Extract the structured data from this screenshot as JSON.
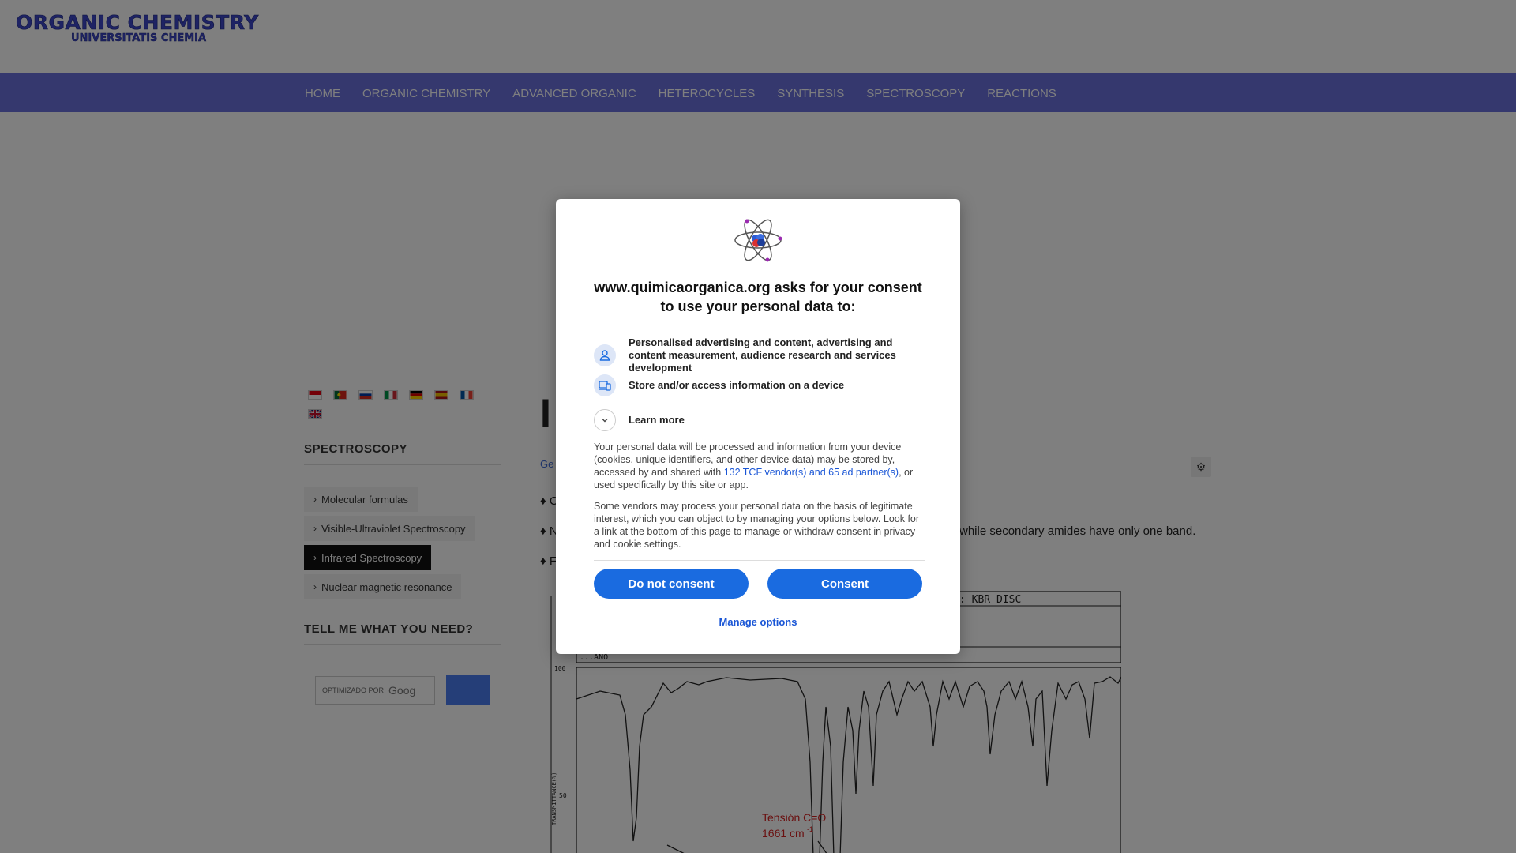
{
  "header": {
    "logo_main": "ORGANIC CHEMISTRY",
    "logo_sub": "UNIVERSITATIS CHEMIA"
  },
  "nav": {
    "items": [
      "HOME",
      "ORGANIC CHEMISTRY",
      "ADVANCED ORGANIC",
      "HETEROCYCLES",
      "SYNTHESIS",
      "SPECTROSCOPY",
      "REACTIONS"
    ]
  },
  "sidebar": {
    "flags": [
      {
        "name": "indonesia-flag",
        "colors": [
          "#e70011",
          "#ffffff"
        ]
      },
      {
        "name": "portugal-flag",
        "colors": [
          "#046a38",
          "#da291c"
        ]
      },
      {
        "name": "russia-flag",
        "colors": [
          "#ffffff",
          "#0039a6",
          "#d52b1e"
        ]
      },
      {
        "name": "italy-flag",
        "colors": [
          "#009246",
          "#ffffff",
          "#ce2b37"
        ]
      },
      {
        "name": "germany-flag",
        "colors": [
          "#000000",
          "#dd0000",
          "#ffce00"
        ]
      },
      {
        "name": "spain-flag",
        "colors": [
          "#aa151b",
          "#f1bf00",
          "#aa151b"
        ]
      },
      {
        "name": "france-flag",
        "colors": [
          "#0055a4",
          "#ffffff",
          "#ef4135"
        ]
      },
      {
        "name": "uk-flag",
        "colors": [
          "#012169",
          "#ffffff",
          "#c8102e"
        ]
      }
    ],
    "spectroscopy_title": "SPECTROSCOPY",
    "links": [
      "Molecular formulas",
      "Visible-Ultraviolet Spectroscopy",
      "Infrared Spectroscopy",
      "Nuclear magnetic resonance"
    ],
    "active_link": "Infrared Spectroscopy",
    "tell_title": "TELL ME WHAT YOU NEED?",
    "search_placeholder": "OPTIMIZADO POR",
    "search_brand": "Goog"
  },
  "content": {
    "h1": "I",
    "breadcrumb": "Ge",
    "bullets": [
      "♦ C",
      "♦ N",
      "♦ F"
    ],
    "bullet_right": "while secondary amides have only one band.",
    "spectrum": {
      "header_right": ": KBR DISC",
      "row_text": "...ANO",
      "y_ticks": [
        "100",
        "50"
      ],
      "y_label": "TRANSMITTANCE(%)",
      "annotation_line1": "Tensión C=O",
      "annotation_line2": "1661 cm",
      "annotation_sup": "-1"
    }
  },
  "consent": {
    "title": "www.quimicaorganica.org asks for your consent to use your personal data to:",
    "purposes": [
      {
        "icon": "person-icon",
        "text": "Personalised advertising and content, advertising and content measurement, audience research and services development"
      },
      {
        "icon": "devices-icon",
        "text": "Store and/or access information on a device"
      }
    ],
    "learn_more": "Learn more",
    "para1_a": "Your personal data will be processed and information from your device (cookies, unique identifiers, and other device data) may be stored by, accessed by and shared with ",
    "para1_link": "132 TCF vendor(s) and 65 ad partner(s)",
    "para1_b": ", or used specifically by this site or app.",
    "para2": "Some vendors may process your personal data on the basis of legitimate interest, which you can object to by managing your options below. Look for a link at the bottom of this page to manage or withdraw consent in privacy and cookie settings.",
    "do_not_consent": "Do not consent",
    "consent": "Consent",
    "manage_options": "Manage options",
    "accent": "#1a6be0"
  }
}
